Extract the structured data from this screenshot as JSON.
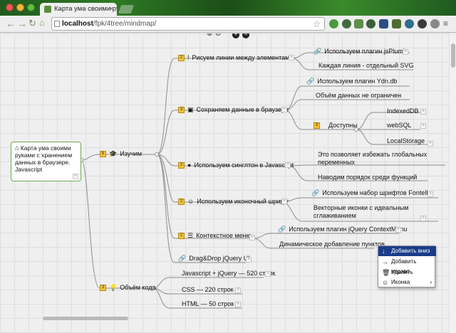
{
  "browser": {
    "tab_title": "Карта ума своими руками",
    "url_host": "localhost",
    "url_path": "/fpk/4tree/mindmap/",
    "close_glyph": "×"
  },
  "toolbar": {
    "zoom_in_glyph": "⊕",
    "zoom_out_glyph": "⊖"
  },
  "root_node": {
    "icon": "home-icon",
    "text": "Карта ума своими руками с хранением данных в браузере. Javascript"
  },
  "nodes": {
    "izuchim": "Изучим",
    "obem_koda": "Объём кода",
    "risuem": "Рисуем линии между элементами",
    "jsplumb": "Используем плагин jsPlumb",
    "svg_line": "Каждая линия - отдельный SVG",
    "sohranyaem": "Сохраняем данные в браузере",
    "ydn": "Используем плагин Ydn.db",
    "obem_dannyh": "Объём данных не ограничен",
    "dostupny": "Доступны",
    "indexeddb": "IndexedDB",
    "websql": "webSQL",
    "localstorage": "LocalStorage",
    "singlton": "Используем синглтон в Javascript",
    "globalnyh": "Это позволяет избежать глобальных переменных",
    "poryadok": "Наводим порядок среди функций",
    "ikonochny": "Используем иконочный шрифт",
    "fontello": "Используем набор шрифтов Fontello",
    "vektornye": "Векторные иконки с идеальным сглаживанием",
    "kontekstnoe": "Контекстное меню",
    "contextmenu": "Используем плагин jQuery ContextMenu",
    "dinamicheskoe": "Динамическое добавление пунктов",
    "dragdrop": "Drag&Drop jQuery UI",
    "js_jquery": "Javascript + jQuery — 520 строк",
    "css": "CSS — 220 строк",
    "html": "HTML — 50 строк"
  },
  "counts": {
    "izuchim": "6",
    "obem_koda": "3",
    "risuem": "2",
    "sohranyaem": "3",
    "dostupny": "3",
    "singlton": "2",
    "ikonochny": "2",
    "kontekstnoe": "2"
  },
  "context_menu": {
    "items": [
      {
        "label": "Добавить вниз",
        "icon": "arrow-down-icon",
        "glyph": "↓"
      },
      {
        "label": "Добавить вправо",
        "icon": "arrow-right-icon",
        "glyph": "→"
      },
      {
        "label": "Удалить",
        "icon": "trash-icon",
        "glyph": "🗑"
      },
      {
        "label": "Иконка",
        "icon": "smile-icon",
        "glyph": "☺",
        "submenu": "›"
      }
    ]
  },
  "colors": {
    "selected_menu_bg": "#1a3c8a",
    "count_badge": "#f2c23b",
    "root_border": "#6aa94c",
    "line": "#8c8c8c"
  }
}
